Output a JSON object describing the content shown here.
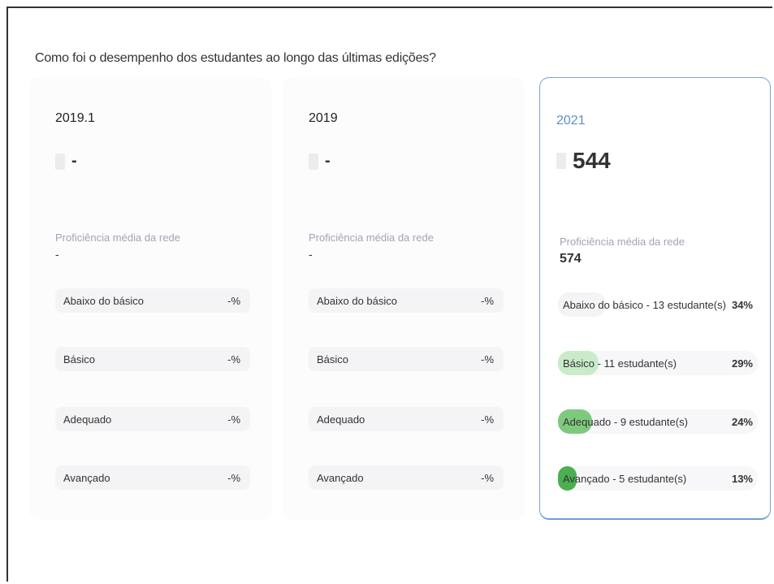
{
  "page": {
    "title": "Como foi o desempenho dos estudantes ao longo das últimas edições?"
  },
  "cards": [
    {
      "year": "2019.1",
      "score": "-",
      "proficiency_label": "Proficiência média da rede",
      "proficiency_value": "-",
      "levels": [
        {
          "label": "Abaixo do básico",
          "percent": "-%"
        },
        {
          "label": "Básico",
          "percent": "-%"
        },
        {
          "label": "Adequado",
          "percent": "-%"
        },
        {
          "label": "Avançado",
          "percent": "-%"
        }
      ]
    },
    {
      "year": "2019",
      "score": "-",
      "proficiency_label": "Proficiência média da rede",
      "proficiency_value": "-",
      "levels": [
        {
          "label": "Abaixo do básico",
          "percent": "-%"
        },
        {
          "label": "Básico",
          "percent": "-%"
        },
        {
          "label": "Adequado",
          "percent": "-%"
        },
        {
          "label": "Avançado",
          "percent": "-%"
        }
      ]
    },
    {
      "year": "2021",
      "score": "544",
      "proficiency_label": "Proficiência média da rede",
      "proficiency_value": "574",
      "levels": [
        {
          "label": "Abaixo do básico - 13 estudante(s)",
          "percent": "34%",
          "fraction": 0.34,
          "color": "#f4f4f6"
        },
        {
          "label": "Básico - 11 estudante(s)",
          "percent": "29%",
          "fraction": 0.29,
          "color": "#c9ebc9"
        },
        {
          "label": "Adequado - 9 estudante(s)",
          "percent": "24%",
          "fraction": 0.24,
          "color": "#7fc97f"
        },
        {
          "label": "Avançado - 5 estudante(s)",
          "percent": "13%",
          "fraction": 0.13,
          "color": "#4caf50"
        }
      ]
    }
  ]
}
